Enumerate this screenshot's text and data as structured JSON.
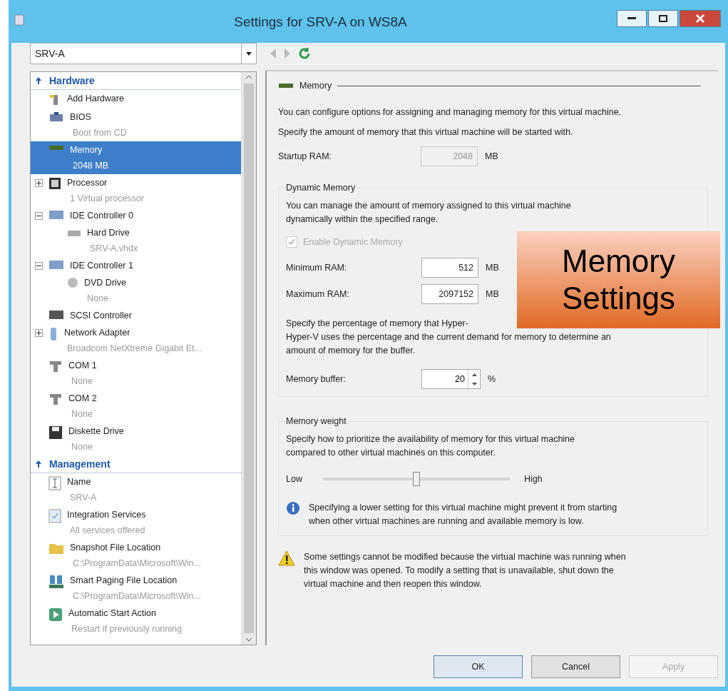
{
  "window": {
    "title": "Settings for SRV-A on WS8A"
  },
  "vm_selector": {
    "value": "SRV-A"
  },
  "tree": [
    {
      "heading": "Hardware",
      "items": [
        {
          "label": "Add Hardware",
          "selected": false
        },
        {
          "label": "BIOS",
          "detail": "Boot from CD",
          "selected": false
        },
        {
          "label": "Memory",
          "detail": "2048 MB",
          "selected": true
        },
        {
          "label": "Processor",
          "detail": "1 Virtual processor",
          "selected": false,
          "expanded": false
        },
        {
          "label": "IDE Controller 0",
          "selected": false,
          "expanded": true,
          "children": [
            {
              "label": "Hard Drive",
              "detail": "SRV-A.vhdx",
              "selected": false
            }
          ]
        },
        {
          "label": "IDE Controller 1",
          "selected": false,
          "expanded": true,
          "children": [
            {
              "label": "DVD Drive",
              "detail": "None",
              "selected": false
            }
          ]
        },
        {
          "label": "SCSI Controller",
          "selected": false
        },
        {
          "label": "Network Adapter",
          "detail": "Broadcom NetXtreme Gigabit Et...",
          "selected": false,
          "expanded": false
        },
        {
          "label": "COM 1",
          "detail": "None",
          "selected": false
        },
        {
          "label": "COM 2",
          "detail": "None",
          "selected": false
        },
        {
          "label": "Diskette Drive",
          "detail": "None",
          "selected": false
        }
      ]
    },
    {
      "heading": "Management",
      "items": [
        {
          "label": "Name",
          "detail": "SRV-A",
          "selected": false
        },
        {
          "label": "Integration Services",
          "detail": "All services offered",
          "selected": false
        },
        {
          "label": "Snapshot File Location",
          "detail": "C:\\ProgramData\\Microsoft\\Win...",
          "selected": false
        },
        {
          "label": "Smart Paging File Location",
          "detail": "C:\\ProgramData\\Microsoft\\Win...",
          "selected": false
        },
        {
          "label": "Automatic Start Action",
          "detail": "Restart if previously running",
          "selected": false
        }
      ]
    }
  ],
  "panel": {
    "title": "Memory",
    "intro": [
      "You can configure options for assigning and managing memory for this virtual machine.",
      "Specify the amount of memory that this virtual machine will be started with."
    ],
    "startup_ram": {
      "label": "Startup RAM:",
      "value": "2048",
      "unit": "MB",
      "disabled": true
    },
    "dynamic_memory": {
      "title": "Dynamic Memory",
      "text": "You can manage the amount of memory assigned to this virtual machine dynamically within the specified range.",
      "enable": {
        "label": "Enable Dynamic Memory",
        "checked": true,
        "disabled": true
      },
      "minimum_ram": {
        "label": "Minimum RAM:",
        "value": "512",
        "unit": "MB"
      },
      "maximum_ram": {
        "label": "Maximum RAM:",
        "value": "2097152",
        "unit": "MB"
      },
      "buffer_text": [
        "Specify the percentage of memory that Hyper-",
        "Hyper-V uses the percentage and the current demand for memory to determine an",
        "amount of memory for the buffer."
      ],
      "memory_buffer": {
        "label": "Memory buffer:",
        "value": "20",
        "unit": "%"
      }
    },
    "memory_weight": {
      "title": "Memory weight",
      "text": "Specify how to prioritize the availability of memory for this virtual machine compared to other virtual machines on this computer.",
      "low": "Low",
      "high": "High",
      "level": 0.5,
      "info": "Specifying a lower setting for this virtual machine might prevent it from starting when other virtual machines are running and available memory is low."
    },
    "warning": "Some settings cannot be modified because the virtual machine was running when this window was opened. To modify a setting that is unavailable, shut down the virtual machine and then reopen this window."
  },
  "buttons": [
    {
      "label": "OK",
      "disabled": false,
      "default": true
    },
    {
      "label": "Cancel",
      "disabled": false,
      "default": false
    },
    {
      "label": "Apply",
      "disabled": true,
      "default": false
    }
  ],
  "callout": {
    "text": "Memory Settings"
  }
}
